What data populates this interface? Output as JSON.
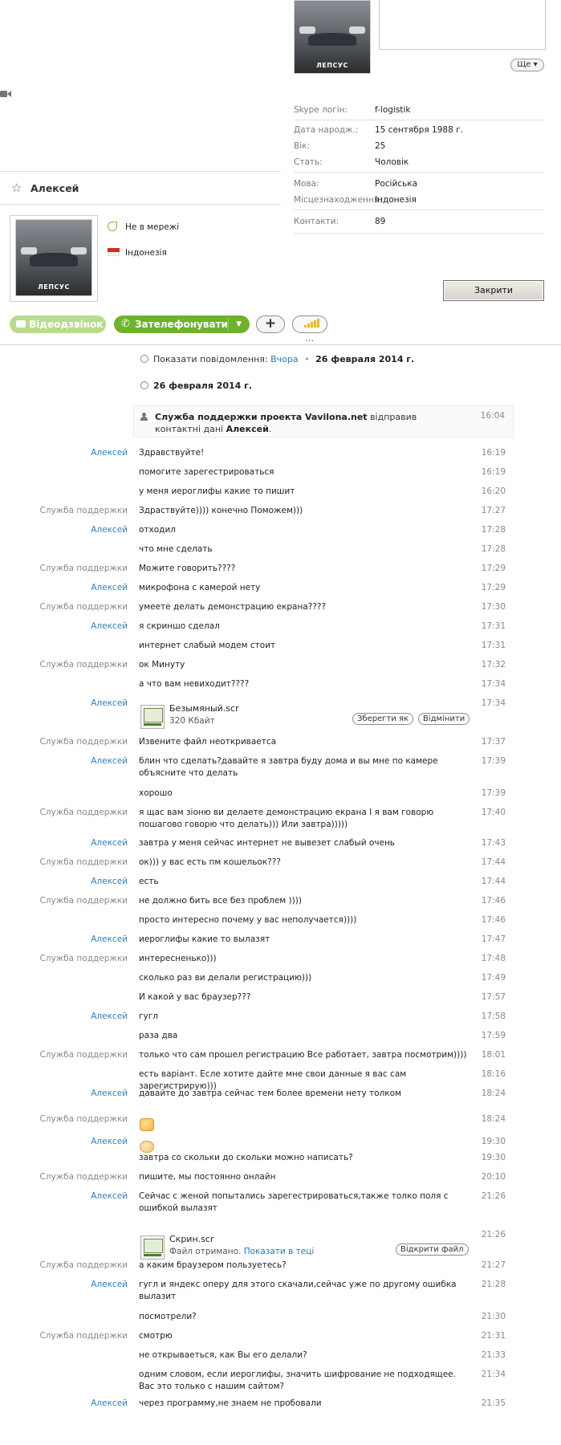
{
  "profile": {
    "photo_label": "ЛЕПСУС",
    "more_button": "Ще ▾",
    "fields": [
      {
        "key": "Skype логін:",
        "value": "f-logistik"
      },
      {
        "key": "Дата народж.:",
        "value": "15 сентября 1988 г."
      },
      {
        "key": "Вік:",
        "value": "25"
      },
      {
        "key": "Стать:",
        "value": "Чоловік"
      },
      {
        "key": "Мова:",
        "value": "Російська"
      },
      {
        "key": "Місцезнаходження:",
        "value": "Індонезія"
      },
      {
        "key": "Контакти:",
        "value": "89"
      }
    ],
    "close_button": "Закрити"
  },
  "contact": {
    "name": "Алексей",
    "status": "Не в мережі",
    "country": "Індонезія",
    "photo_label": "ЛЕПСУС"
  },
  "toolbar": {
    "video_call": "Відеодзвінок",
    "call": "Зателефонувати",
    "add": "+",
    "more_dots": "…"
  },
  "colors": {
    "accent_green": "#6fb22b",
    "link_blue": "#1c7cc8",
    "status_green": "#7fbf3f"
  },
  "chat": {
    "history_prefix": "Показати повідомлення:",
    "history_link": "Вчора",
    "history_bullet": "•",
    "history_date": "26 февраля 2014 г.",
    "date_header": "26 февраля 2014 г.",
    "contact_notice": {
      "sender": "Служба поддержки проекта Vavilona.net",
      "text": " відправив контактні дані ",
      "contact": "Алексей",
      "dot": ".",
      "time": "16:04"
    },
    "messages": [
      {
        "sender": "Алексей",
        "text": "Здравствуйте!",
        "time": "16:19"
      },
      {
        "sender": "",
        "text": "помогите зарегестрироваться",
        "time": "16:19"
      },
      {
        "sender": "",
        "text": "у меня иероглифы какие то пишит",
        "time": "16:20"
      },
      {
        "sender": "Служба поддержки",
        "text": "Здраствуйте)))) конечно Поможем)))",
        "time": "17:27"
      },
      {
        "sender": "Алексей",
        "text": "отходил",
        "time": "17:28"
      },
      {
        "sender": "",
        "text": "что мне сделать",
        "time": "17:28"
      },
      {
        "sender": "Служба поддержки",
        "text": " Можите говорить????",
        "time": "17:29"
      },
      {
        "sender": "Алексей",
        "text": "микрофона с камерой нету",
        "time": "17:29"
      },
      {
        "sender": "Служба поддержки",
        "text": "умеете делать демонстрацию екрана????",
        "time": "17:30"
      },
      {
        "sender": "Алексей",
        "text": "я скриншо сделал",
        "time": "17:31"
      },
      {
        "sender": "",
        "text": "интернет слабый модем стоит",
        "time": "17:31"
      },
      {
        "sender": "Служба поддержки",
        "text": "ок Минуту",
        "time": "17:32"
      },
      {
        "sender": "",
        "text": "а что вам невиходит????",
        "time": "17:34"
      },
      {
        "sender": "Алексей",
        "text": "",
        "time": "17:34"
      },
      {
        "sender": "Служба поддержки",
        "text": "Извените файл неоткриваетса",
        "time": "17:37"
      },
      {
        "sender": "Алексей",
        "text": "блин что сделать?давайте я завтра буду дома и вы мне по камере объясните что делать",
        "time": "17:39"
      },
      {
        "sender": "",
        "text": "хорошо",
        "time": "17:39"
      },
      {
        "sender": "Служба поддержки",
        "text": "я щас вам зіоню ви делаете демонстрацию екрана I я вам говорю пошагово говорю что делать)))  Или завтра)))))",
        "time": "17:40"
      },
      {
        "sender": "Алексей",
        "text": "завтра у меня сейчас интернет не вывезет слабый очень",
        "time": "17:43"
      },
      {
        "sender": "Служба поддержки",
        "text": "ок))) у вас есть пм кошельок???",
        "time": "17:44"
      },
      {
        "sender": "Алексей",
        "text": "есть",
        "time": "17:44"
      },
      {
        "sender": "Служба поддержки",
        "text": "не должно бить все без проблем ))))",
        "time": "17:46"
      },
      {
        "sender": "",
        "text": "просто интересно почему у вас неполучается))))",
        "time": "17:46"
      },
      {
        "sender": "Алексей",
        "text": "иероглифы какие то вылазят",
        "time": "17:47"
      },
      {
        "sender": "Служба поддержки",
        "text": "интересненько)))",
        "time": "17:48"
      },
      {
        "sender": "",
        "text": "сколько раз ви делали регистрацию)))",
        "time": "17:49"
      },
      {
        "sender": "",
        "text": "И какой у вас браузер???",
        "time": "17:57"
      },
      {
        "sender": "Алексей",
        "text": "гугл",
        "time": "17:58"
      },
      {
        "sender": "",
        "text": "раза два",
        "time": "17:59"
      },
      {
        "sender": "Служба поддержки",
        "text": "только что сам прошел регистрацию Все работает, завтра посмотрим))))",
        "time": "18:01"
      },
      {
        "sender": "",
        "text": "есть варіант.  Есле хотите дайте мне свои данные я вас сам зарегистрирую)))",
        "time": "18:16"
      },
      {
        "sender": "Алексей",
        "text": "давайте до завтра сейчас тем более времени нету толком",
        "time": "18:24"
      },
      {
        "sender": "Служба поддержки",
        "text": "",
        "time": "18:24"
      },
      {
        "sender": "Алексей",
        "text": "",
        "time": "19:30"
      },
      {
        "sender": "",
        "text": "завтра со скольки до скольки можно написать?",
        "time": "19:30"
      },
      {
        "sender": "Служба поддержки",
        "text": "пишите, мы постоянно онлайн",
        "time": "20:10"
      },
      {
        "sender": "Алексей",
        "text": "Сейчас с женой попытались зарегестрироваться,также толко поля с ошибкой вылазят",
        "time": "21:26"
      },
      {
        "sender": "",
        "text": "",
        "time": "21:26"
      },
      {
        "sender": "Служба поддержки",
        "text": "а каким браузером пользуетесь?",
        "time": "21:27"
      },
      {
        "sender": "Алексей",
        "text": "гугл и яндекс оперу для этого скачали,сейчас уже по другому ошибка вылазит",
        "time": "21:28"
      },
      {
        "sender": "",
        "text": "посмотрели?",
        "time": "21:30"
      },
      {
        "sender": "Служба поддержки",
        "text": "смотрю",
        "time": "21:31"
      },
      {
        "sender": "",
        "text": "не открываеться, как Вы его делали?",
        "time": "21:33"
      },
      {
        "sender": "",
        "text": "одним словом, если иероглифы, значить шифрование не подходящее. Вас это только с нашим сайтом?",
        "time": "21:34"
      },
      {
        "sender": "Алексей",
        "text": "через программу,не знаем не пробовали",
        "time": "21:35"
      }
    ],
    "file1": {
      "name": "Безымяный.scr",
      "size": "320 Кбайт",
      "save": "Зберегти як",
      "decline": "Відмінити"
    },
    "file2": {
      "name": "Скрин.scr",
      "status": "Файл отримано.",
      "show_link": "Показати в теці",
      "open": "Відкрити файл"
    }
  }
}
